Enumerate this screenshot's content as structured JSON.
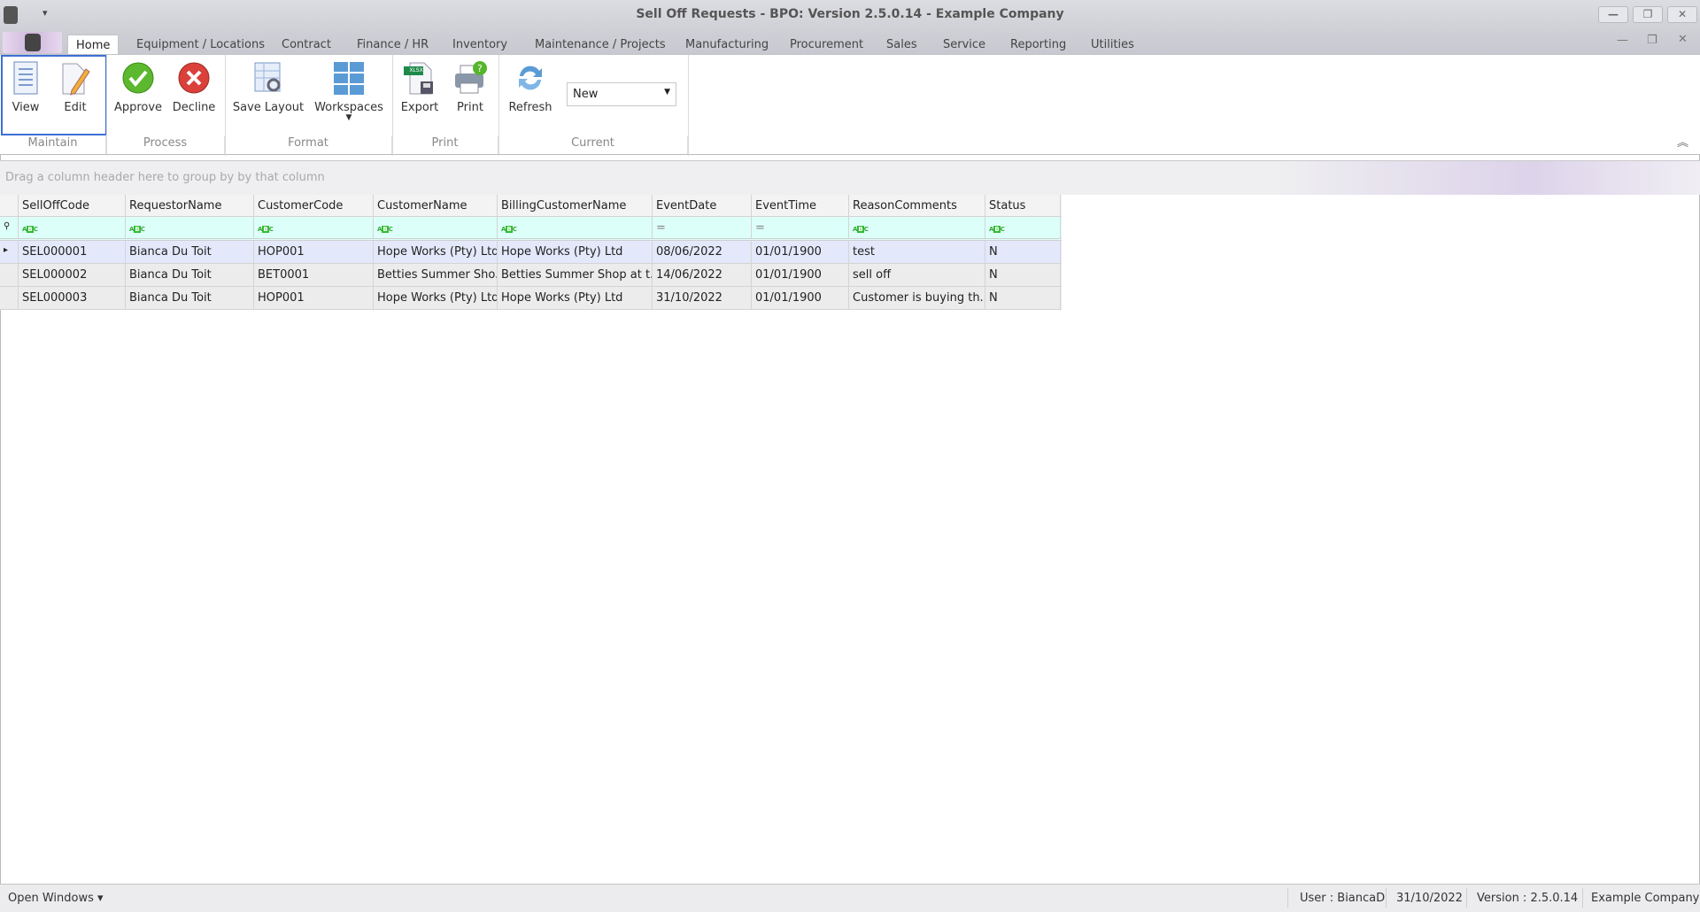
{
  "window": {
    "title": "Sell Off Requests - BPO: Version 2.5.0.14 - Example Company",
    "minimize": "—",
    "restore": "❐",
    "close": "✕"
  },
  "tabs": [
    "Home",
    "Equipment / Locations",
    "Contract",
    "Finance / HR",
    "Inventory",
    "Maintenance / Projects",
    "Manufacturing",
    "Procurement",
    "Sales",
    "Service",
    "Reporting",
    "Utilities"
  ],
  "ribbon": {
    "buttons": {
      "view": "View",
      "edit": "Edit",
      "approve": "Approve",
      "decline": "Decline",
      "save_layout": "Save Layout",
      "workspaces": "Workspaces",
      "export": "Export",
      "print": "Print",
      "refresh": "Refresh"
    },
    "current_select": "New",
    "groups": {
      "maintain": "Maintain",
      "process": "Process",
      "format": "Format",
      "print": "Print",
      "current": "Current"
    },
    "export_badge": "XLSX"
  },
  "grid": {
    "groupby_hint": "Drag a column header here to group by by that column",
    "columns": [
      "SellOffCode",
      "RequestorName",
      "CustomerCode",
      "CustomerName",
      "BillingCustomerName",
      "EventDate",
      "EventTime",
      "ReasonComments",
      "Status"
    ],
    "filter_types": [
      "text",
      "text",
      "text",
      "text",
      "text",
      "equals",
      "equals",
      "text",
      "text"
    ],
    "rows": [
      [
        "SEL000001",
        "Bianca Du Toit",
        "HOP001",
        "Hope Works (Pty) Ltd",
        "Hope Works (Pty) Ltd",
        "08/06/2022",
        "01/01/1900",
        "test",
        "N"
      ],
      [
        "SEL000002",
        "Bianca Du Toit",
        "BET0001",
        "Betties Summer Sho...",
        "Betties Summer Shop at t...",
        "14/06/2022",
        "01/01/1900",
        "sell off",
        "N"
      ],
      [
        "SEL000003",
        "Bianca Du Toit",
        "HOP001",
        "Hope Works (Pty) Ltd",
        "Hope Works (Pty) Ltd",
        "31/10/2022",
        "01/01/1900",
        "Customer is buying th...",
        "N"
      ]
    ]
  },
  "status": {
    "open_windows": "Open Windows ▾",
    "user": "User : BiancaD",
    "date": "31/10/2022",
    "version": "Version : 2.5.0.14",
    "company": "Example Company"
  }
}
